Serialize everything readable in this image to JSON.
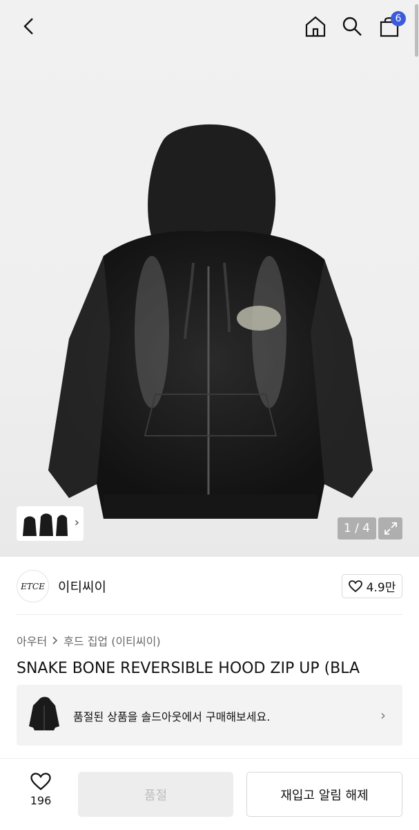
{
  "header": {
    "icons": [
      "back-icon",
      "home-icon",
      "search-icon",
      "cart-icon"
    ],
    "cart_count": "6"
  },
  "gallery": {
    "counter": "1 / 4",
    "thumbnail_arrow": "›"
  },
  "brand": {
    "logo_text": "ETCE",
    "name": "이티씨이",
    "like_count": "4.9만"
  },
  "breadcrumb": {
    "items": [
      "아우터",
      "후드 집업 (이티씨이)"
    ]
  },
  "product": {
    "title": "SNAKE BONE REVERSIBLE HOOD ZIP UP (BLA"
  },
  "banner": {
    "text": "품절된 상품을 솔드아웃에서 구매해보세요.",
    "arrow": "›"
  },
  "bottom_bar": {
    "wish_count": "196",
    "soldout_label": "품절",
    "restock_label": "재입고 알림 해제"
  },
  "colors": {
    "badge": "#3b5bdb",
    "hoodie": "#1a1a1a"
  }
}
